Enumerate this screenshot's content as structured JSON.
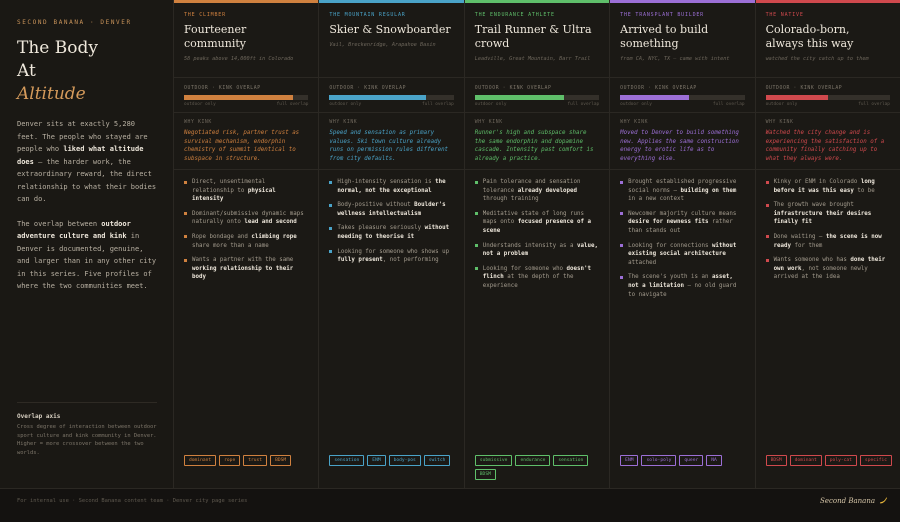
{
  "brand": "SECOND BANANA · DENVER",
  "title": {
    "line1": "The Body",
    "line2": "At",
    "line3": "Altitude"
  },
  "intro": {
    "p1_a": "Denver sits at exactly 5,280 feet. The people who stayed are people who ",
    "p1_b": "liked what altitude does",
    "p1_c": " — the harder work, the extraordinary reward, the direct relationship to what their bodies can do.",
    "p2_a": "The overlap between ",
    "p2_b": "outdoor adventure culture and kink",
    "p2_c": " in Denver is documented, genuine, and larger than in any other city in this series. Five profiles of where the two communities meet."
  },
  "overlap": {
    "title": "Overlap axis",
    "text": "Cross degree of interaction between outdoor sport culture and kink community in Denver. Higher = more crossover between the two worlds."
  },
  "meter_label": "OUTDOOR · KINK OVERLAP",
  "meter_left": "outdoor only",
  "meter_right": "full overlap",
  "why_label": "WHY KINK",
  "columns": [
    {
      "color": "#d0813f",
      "kicker": "THE CLIMBER",
      "title": "Fourteener community",
      "sub": "58 peaks above 14,000ft in Colorado",
      "overlap": 0.88,
      "why": "Negotiated risk, partner trust as survival mechanism, endorphin chemistry of summit identical to subspace in structure.",
      "bullets": [
        {
          "a": "Direct, unsentimental relationship to ",
          "b": "physical intensity",
          "c": ""
        },
        {
          "a": "Dominant/submissive dynamic maps naturally onto ",
          "b": "lead and second",
          "c": ""
        },
        {
          "a": "Rope bondage and ",
          "b": "climbing rope",
          "c": " share more than a name"
        },
        {
          "a": "Wants a partner with the same ",
          "b": "working relationship to their body",
          "c": ""
        }
      ],
      "tags": [
        "dominant",
        "rope",
        "trust",
        "BDSM"
      ]
    },
    {
      "color": "#4aa3c8",
      "kicker": "THE MOUNTAIN REGULAR",
      "title": "Skier & Snowboarder",
      "sub": "Vail, Breckenridge, Arapahoe Basin",
      "overlap": 0.78,
      "why": "Speed and sensation as primary values. Ski town culture already runs on permission rules different from city defaults.",
      "bullets": [
        {
          "a": "High-intensity sensation is ",
          "b": "the normal, not the exceptional",
          "c": ""
        },
        {
          "a": "Body-positive without ",
          "b": "Boulder's wellness intellectualism",
          "c": ""
        },
        {
          "a": "Takes pleasure seriously ",
          "b": "without needing to theorise it",
          "c": ""
        },
        {
          "a": "Looking for someone who shows up ",
          "b": "fully present",
          "c": ", not performing"
        }
      ],
      "tags": [
        "sensation",
        "ENM",
        "body-pos",
        "switch"
      ]
    },
    {
      "color": "#5fbf6a",
      "kicker": "THE ENDURANCE ATHLETE",
      "title": "Trail Runner & Ultra crowd",
      "sub": "Leadville, Great Mountain, Barr Trail",
      "overlap": 0.72,
      "why": "Runner's high and subspace share the same endorphin and dopamine cascade. Intensity past comfort is already a practice.",
      "bullets": [
        {
          "a": "Pain tolerance and sensation tolerance ",
          "b": "already developed",
          "c": " through training"
        },
        {
          "a": "Meditative state of long runs maps onto ",
          "b": "focused presence of a scene",
          "c": ""
        },
        {
          "a": "Understands intensity as a ",
          "b": "value, not a problem",
          "c": ""
        },
        {
          "a": "Looking for someone who ",
          "b": "doesn't flinch",
          "c": " at the depth of the experience"
        }
      ],
      "tags": [
        "submissive",
        "endurance",
        "sensation",
        "BDSM"
      ]
    },
    {
      "color": "#9c6fd6",
      "kicker": "THE TRANSPLANT BUILDER",
      "title": "Arrived to build something",
      "sub": "from CA, NYC, TX — came with intent",
      "overlap": 0.55,
      "why": "Moved to Denver to build something new. Applies the same construction energy to erotic life as to everything else.",
      "bullets": [
        {
          "a": "Brought established progressive social norms — ",
          "b": "building on them",
          "c": " in a new context"
        },
        {
          "a": "Newcomer majority culture means ",
          "b": "desire for newness fits",
          "c": " rather than stands out"
        },
        {
          "a": "Looking for connections ",
          "b": "without existing social architecture",
          "c": " attached"
        },
        {
          "a": "The scene's youth is an ",
          "b": "asset, not a limitation",
          "c": " — no old guard to navigate"
        }
      ],
      "tags": [
        "ENM",
        "solo-poly",
        "queer",
        "NA"
      ]
    },
    {
      "color": "#d0494d",
      "kicker": "THE NATIVE",
      "title": "Colorado-born, always this way",
      "sub": "watched the city catch up to them",
      "overlap": 0.5,
      "why": "Watched the city change and is experiencing the satisfaction of a community finally catching up to what they always were.",
      "bullets": [
        {
          "a": "Kinky or ENM in Colorado ",
          "b": "long before it was this easy",
          "c": " to be"
        },
        {
          "a": "The growth wave brought ",
          "b": "infrastructure their desires finally fit",
          "c": ""
        },
        {
          "a": "Done waiting — ",
          "b": "the scene is now ready",
          "c": " for them"
        },
        {
          "a": "Wants someone who has ",
          "b": "done their own work",
          "c": ", not someone newly arrived at the idea"
        }
      ],
      "tags": [
        "BDSM",
        "dominant",
        "poly-cat",
        "specific"
      ]
    }
  ],
  "footer": {
    "text": "For internal use · Second Banana content team · Denver city page series",
    "brand": "Second Banana"
  }
}
